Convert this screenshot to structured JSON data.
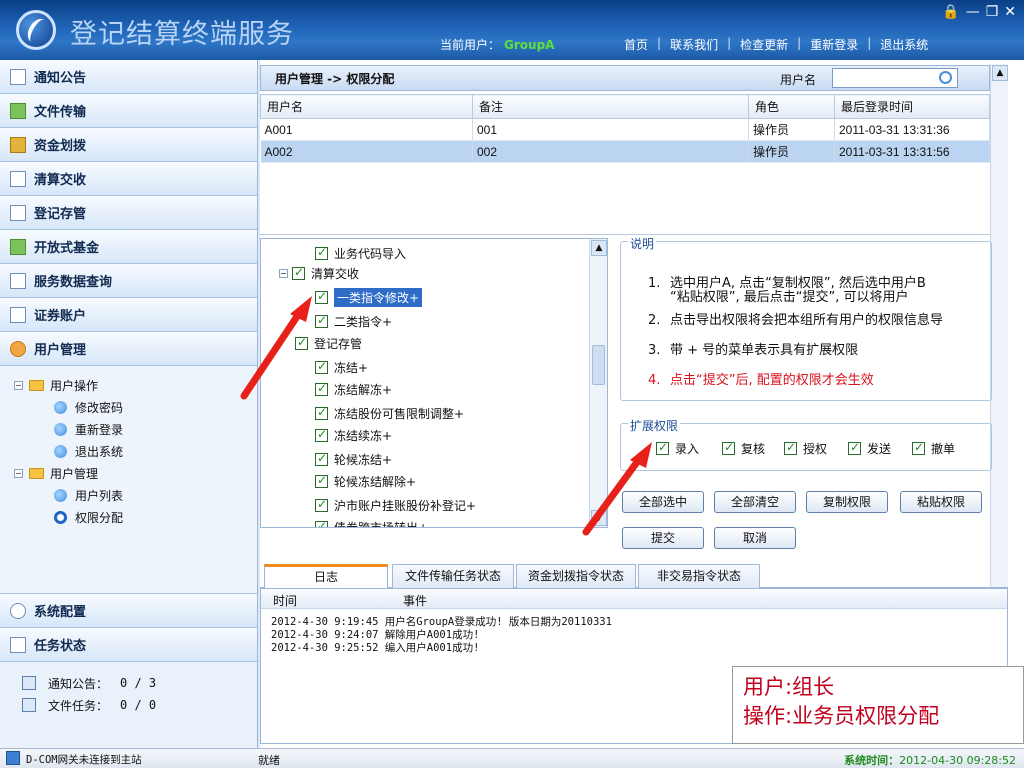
{
  "app": {
    "title": "登记结算终端服务",
    "current_user_label": "当前用户：",
    "current_user": "GroupA"
  },
  "topnav": [
    "首页",
    "联系我们",
    "检查更新",
    "重新登录",
    "退出系统"
  ],
  "sidebar": {
    "items_top": [
      {
        "label": "通知公告",
        "icon": "notice-icon"
      },
      {
        "label": "文件传输",
        "icon": "file-transfer-icon"
      },
      {
        "label": "资金划拨",
        "icon": "fund-transfer-icon"
      },
      {
        "label": "清算交收",
        "icon": "settlement-icon"
      },
      {
        "label": "登记存管",
        "icon": "registry-icon"
      },
      {
        "label": "开放式基金",
        "icon": "fund-icon"
      },
      {
        "label": "服务数据查询",
        "icon": "query-icon"
      },
      {
        "label": "证券账户",
        "icon": "account-icon"
      },
      {
        "label": "用户管理",
        "icon": "users-icon"
      }
    ],
    "tree": {
      "group1": "用户操作",
      "group1_items": [
        "修改密码",
        "重新登录",
        "退出系统"
      ],
      "group2": "用户管理",
      "group2_items": [
        "用户列表",
        "权限分配"
      ]
    },
    "items_bottom": [
      {
        "label": "系统配置",
        "icon": "gear-icon"
      },
      {
        "label": "任务状态",
        "icon": "task-icon"
      }
    ],
    "task_status": [
      {
        "label": "通知公告：",
        "value": "0 / 3"
      },
      {
        "label": "文件任务：",
        "value": "0 / 0"
      }
    ]
  },
  "main": {
    "breadcrumb": "用户管理 -> 权限分配",
    "search_label": "用户名",
    "search_value": "",
    "table": {
      "headers": [
        "用户名",
        "备注",
        "角色",
        "最后登录时间"
      ],
      "rows": [
        [
          "A001",
          "001",
          "操作员",
          "2011-03-31 13:31:36"
        ],
        [
          "A002",
          "002",
          "操作员",
          "2011-03-31 13:31:56"
        ]
      ]
    },
    "perm_tree": [
      "业务代码导入",
      "清算交收",
      "一类指令修改+",
      "二类指令+",
      "登记存管",
      "冻结+",
      "冻结解冻+",
      "冻结股份可售限制调整+",
      "冻结续冻+",
      "轮候冻结+",
      "轮候冻结解除+",
      "沪市账户挂账股份补登记+",
      "债券跨市场转出+"
    ],
    "desc": {
      "legend": "说明",
      "items": [
        {
          "num": "1.",
          "text": "选中用户A, 点击“复制权限”, 然后选中用户B"
        },
        {
          "num": "",
          "text": "“粘贴权限”, 最后点击“提交”, 可以将用户"
        },
        {
          "num": "2.",
          "text": "点击导出权限将会把本组所有用户的权限信息导"
        },
        {
          "num": "3.",
          "text": "带 + 号的菜单表示具有扩展权限"
        },
        {
          "num": "4.",
          "text": "点击“提交”后, 配置的权限才会生效"
        }
      ]
    },
    "ext": {
      "legend": "扩展权限",
      "options": [
        "录入",
        "复核",
        "授权",
        "发送",
        "撤单"
      ]
    },
    "buttons": [
      "全部选中",
      "全部清空",
      "复制权限",
      "粘贴权限",
      "提交",
      "取消"
    ],
    "tabs": [
      "日志",
      "文件传输任务状态",
      "资金划拨指令状态",
      "非交易指令状态"
    ],
    "log": {
      "headers": [
        "时间",
        "事件"
      ],
      "lines": [
        "2012-4-30 9:19:45 用户名GroupA登录成功! 版本日期为20110331",
        "2012-4-30 9:24:07 解除用户A001成功!",
        "2012-4-30 9:25:52 编入用户A001成功!"
      ]
    },
    "annotation": [
      "用户:组长",
      "操作:业务员权限分配"
    ]
  },
  "statusbar": {
    "conn": "D-COM网关未连接到主站",
    "state": "就绪",
    "time_label": "系统时间：",
    "time": "2012-04-30 09:28:52"
  },
  "colors": {
    "accent": "#1f64b8",
    "highlight": "#c0001c",
    "user": "#5fe03a"
  }
}
